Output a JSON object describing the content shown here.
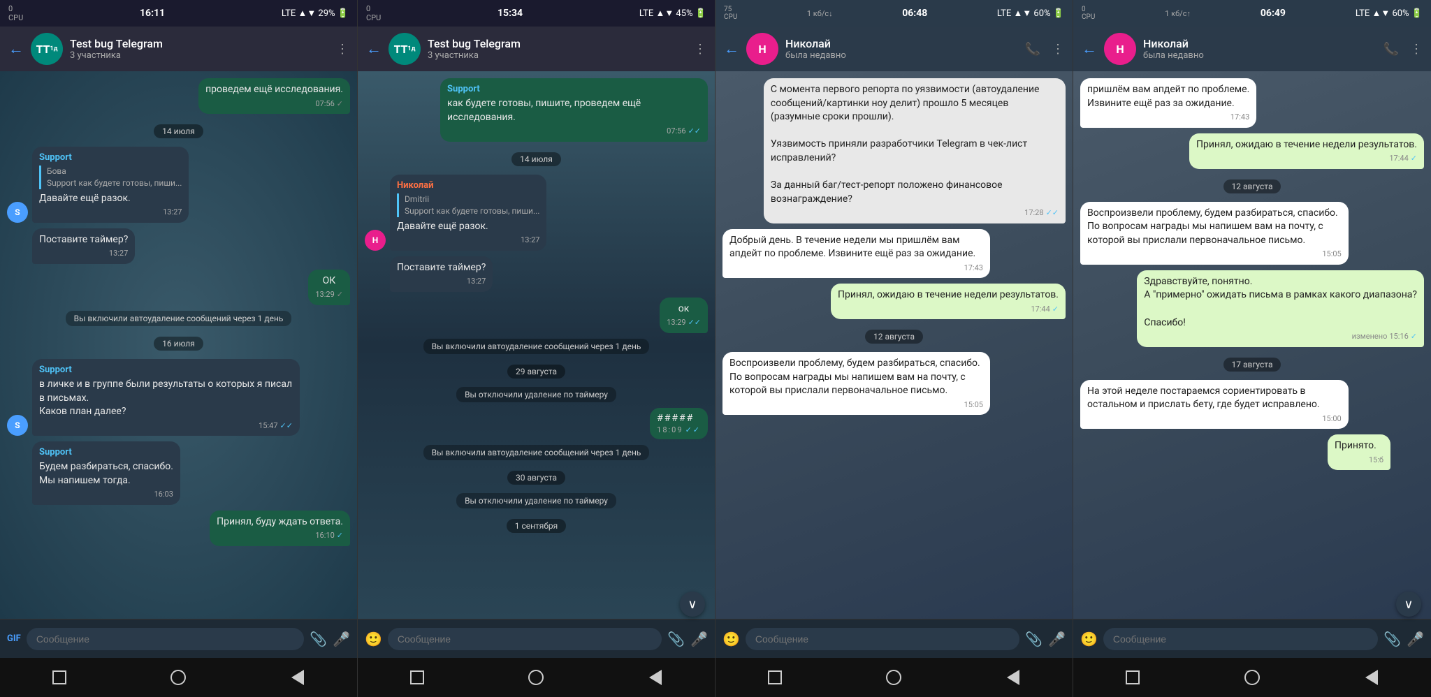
{
  "screens": [
    {
      "id": "screen1",
      "status": {
        "left": "0 CPU",
        "signal": "LTE ▲▼",
        "battery": "29%",
        "time": "16:11"
      },
      "header": {
        "name": "Test bug Telegram",
        "sub": "3 участника",
        "avatar": "TT",
        "avatar_color": "teal"
      },
      "messages": [
        {
          "type": "outgoing",
          "text": "проведем ещё исследования.",
          "time": "07:56",
          "check": "✓"
        },
        {
          "type": "date",
          "text": "14 июля"
        },
        {
          "type": "incoming_quoted",
          "sender": "Support",
          "sender_color": "support",
          "quote_author": "Бова",
          "quote_text": "Support как будете готовы, пиши...",
          "text": "Давайте ещё разок.",
          "time": "13:27",
          "avatar": "S",
          "avatar_color": "#4a9eff"
        },
        {
          "type": "incoming",
          "sender": null,
          "text": "Поставите таймер?",
          "time": "13:27",
          "avatar": "S",
          "avatar_color": "#4a9eff"
        },
        {
          "type": "outgoing",
          "text": "ОК",
          "time": "13:29",
          "check": "✓"
        },
        {
          "type": "system",
          "text": "Вы включили автоудаление сообщений через 1 день"
        },
        {
          "type": "date",
          "text": "16 июля"
        },
        {
          "type": "incoming_quoted",
          "sender": "Support",
          "sender_color": "support",
          "quote_author": null,
          "quote_text": null,
          "text": "в личке и в группе были результаты о которых я писал в письмах.\nКаков план далее?",
          "time": "15:47",
          "avatar": "S",
          "avatar_color": "#4a9eff",
          "check": "✓"
        },
        {
          "type": "incoming",
          "sender": "Support",
          "sender_color": "support",
          "text": "Будем разбираться, спасибо.\nМы напишем тогда.",
          "time": "16:03",
          "avatar": "S",
          "avatar_color": "#4a9eff"
        },
        {
          "type": "outgoing",
          "text": "Принял, буду ждать ответа.",
          "time": "16:10",
          "check": "✓"
        }
      ],
      "input_placeholder": "Сообщение",
      "input_label": "GIF"
    },
    {
      "id": "screen2",
      "status": {
        "left": "0 CPU",
        "signal": "LTE ▲▼",
        "battery": "45%",
        "time": "15:34"
      },
      "header": {
        "name": "Test bug Telegram",
        "sub": "3 участника",
        "avatar": "TT",
        "avatar_color": "teal"
      },
      "messages": [
        {
          "type": "outgoing",
          "text": "проведем ещё исследования.",
          "time": "07:56",
          "check": "✓✓"
        },
        {
          "type": "date",
          "text": "14 июля"
        },
        {
          "type": "incoming_nikolay",
          "sender": "Николай",
          "sender_color": "nikolay",
          "quote_author": "Dmitrii",
          "quote_text": "Support как будете готовы, пиши...",
          "text": "Давайте ещё разок.",
          "time": "13:27",
          "avatar": "H",
          "avatar_color": "#e91e8c"
        },
        {
          "type": "incoming",
          "sender": null,
          "text": "Поставите таймер?",
          "time": "13:27",
          "avatar": "H",
          "avatar_color": "#e91e8c"
        },
        {
          "type": "outgoing_ok",
          "text": "ок",
          "time": "13:29",
          "check": "✓✓"
        },
        {
          "type": "system",
          "text": "Вы включили автоудаление сообщений через 1 день"
        },
        {
          "type": "date",
          "text": "29 августа"
        },
        {
          "type": "system",
          "text": "Вы отключили удаление по таймеру"
        },
        {
          "type": "outgoing_censored",
          "text": "#####",
          "time": "18:09",
          "check": "✓✓"
        },
        {
          "type": "system",
          "text": "Вы включили автоудаление сообщений через 1 день"
        },
        {
          "type": "date",
          "text": "30 августа"
        },
        {
          "type": "system",
          "text": "Вы отключили удаление по таймеру"
        },
        {
          "type": "date",
          "text": "1 сентября"
        }
      ],
      "input_placeholder": "Сообщение"
    },
    {
      "id": "screen3",
      "status": {
        "left": "75 CPU",
        "net": "1 кб/с↓",
        "signal": "LTE ▲▼",
        "battery": "60%",
        "time": "06:48"
      },
      "header": {
        "name": "Николай",
        "sub": "была недавно",
        "avatar": "Н",
        "avatar_color": "pink",
        "has_call": true
      },
      "messages": [
        {
          "type": "incoming_long",
          "text": "С момента первого репорта по уязвимости (автоудаление сообщений/картинки ноу делит) прошло 5 месяцев (разумные сроки прошли).\n\nУязвимость приняли разработчики Telegram в чек-лист исправлений?\n\nЗа данный баг/тест-репорт положено финансовое вознаграждение?",
          "time": "17:28",
          "check": "✓✓"
        },
        {
          "type": "incoming_white",
          "text": "Добрый день. В течение недели мы пришлём вам апдейт по проблеме. Извините ещё раз за ожидание.",
          "time": "17:43"
        },
        {
          "type": "outgoing_light",
          "text": "Принял, ожидаю в течение недели результатов.",
          "time": "17:44",
          "check": "✓"
        },
        {
          "type": "date",
          "text": "12 августа"
        },
        {
          "type": "incoming_white",
          "text": "Воспроизвели проблему, будем разбираться, спасибо. По вопросам награды мы напишем вам на почту, с которой вы прислали первоначальное письмо.",
          "time": "15:05"
        }
      ],
      "input_placeholder": "Сообщение"
    },
    {
      "id": "screen4",
      "status": {
        "left": "0 CPU",
        "net": "1 кб/с↑",
        "signal": "LTE ▲▼",
        "battery": "60%",
        "time": "06:49"
      },
      "header": {
        "name": "Николай",
        "sub": "была недавно",
        "avatar": "Н",
        "avatar_color": "pink",
        "has_call": true
      },
      "messages": [
        {
          "type": "incoming_white",
          "text": "пришлём вам апдейт по проблеме.\nИзвините ещё раз за ожидание.",
          "time": "17:43"
        },
        {
          "type": "outgoing_light",
          "text": "Принял, ожидаю в течение недели результатов.",
          "time": "17:44",
          "check": "✓"
        },
        {
          "type": "date",
          "text": "12 августа"
        },
        {
          "type": "incoming_white",
          "text": "Воспроизвели проблему, будем разбираться, спасибо. По вопросам награды мы напишем вам на почту, с которой вы прислали первоначальное письмо.",
          "time": "15:05"
        },
        {
          "type": "outgoing_light",
          "text": "Здравствуйте, понятно.\nА \"примерно\" ожидать письма в рамках какого диапазона?\n\nСпасибо!",
          "time": "15:16",
          "check": "✓",
          "edited": true
        },
        {
          "type": "date",
          "text": "17 августа"
        },
        {
          "type": "incoming_white",
          "text": "На этой неделе постараемся сориентировать в остальном и прислать бету, где будет исправлено.",
          "time": "15:00"
        },
        {
          "type": "outgoing_light_partial",
          "text": "Принято.",
          "time": "15:b"
        }
      ],
      "input_placeholder": "Сообщение"
    }
  ]
}
